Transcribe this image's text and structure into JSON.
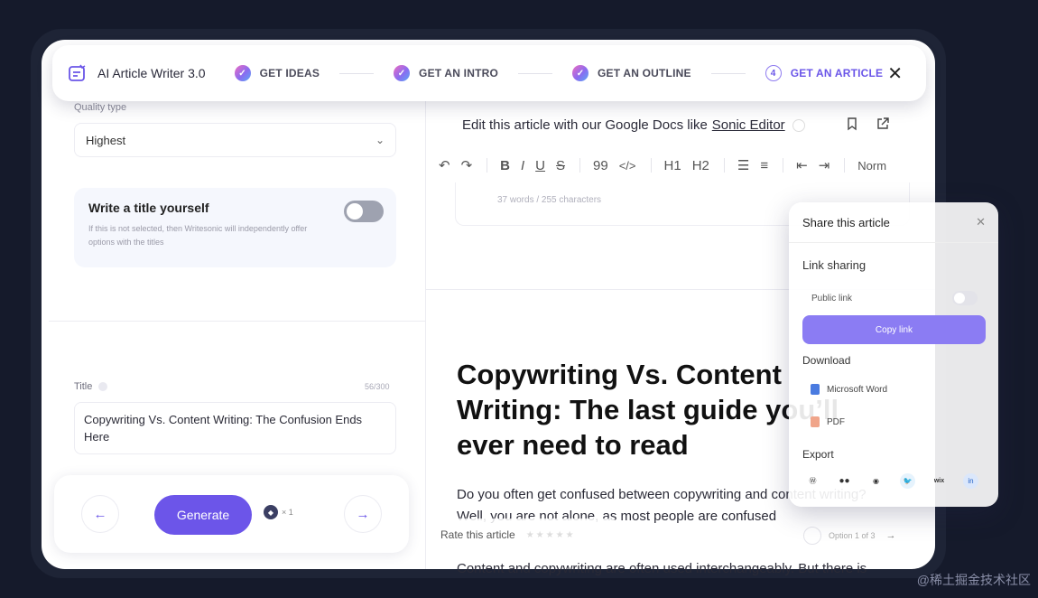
{
  "app": {
    "title": "AI Article Writer 3.0"
  },
  "steps": [
    {
      "label": "GET IDEAS",
      "state": "done",
      "marker": ""
    },
    {
      "label": "GET AN INTRO",
      "state": "done",
      "marker": ""
    },
    {
      "label": "GET AN OUTLINE",
      "state": "done",
      "marker": ""
    },
    {
      "label": "GET AN ARTICLE",
      "state": "active",
      "marker": "4"
    }
  ],
  "left": {
    "quality_label": "Quality type",
    "quality_value": "Highest",
    "title_toggle": {
      "heading": "Write a title yourself",
      "description": "If this is not selected, then Writesonic will independently offer options with the titles",
      "on": false
    },
    "title_label": "Title",
    "title_count": "56/300",
    "title_value": "Copywriting Vs. Content Writing: The Confusion Ends Here",
    "generate_label": "Generate",
    "credits": "× 1"
  },
  "editor": {
    "banner_text": "Edit this article with our Google Docs like",
    "banner_link": "Sonic Editor",
    "toolbar_heading_1": "H1",
    "toolbar_heading_2": "H2",
    "toolbar_quote": "99",
    "toolbar_code": "</>",
    "toolbar_format": "Norm",
    "stats": "37 words / 255 characters",
    "headline": "Copywriting Vs. Content Writing: The last guide you’ll ever need to read",
    "para1": "Do you often get confused between copywriting and content writing? Well, you are not alone, as most people are confused",
    "para2": "Content and copywriting are often used interchangeably. But there is",
    "rate_label": "Rate this article",
    "option_label": "Option 1 of 3"
  },
  "share": {
    "title": "Share this article",
    "link_sharing": "Link sharing",
    "public_link": "Public link",
    "public_on": false,
    "copy_link": "Copy link",
    "download": "Download",
    "download_items": [
      "Microsoft Word",
      "PDF"
    ],
    "export": "Export",
    "export_targets": [
      "wordpress-icon",
      "medium-icon",
      "ghost-icon",
      "twitter-icon",
      "wix-icon",
      "linkedin-icon"
    ]
  },
  "watermark": "@稀土掘金技术社区",
  "colors": {
    "accent": "#6c55e9",
    "background": "#151a2b",
    "copy_button": "#8b7cf3"
  }
}
